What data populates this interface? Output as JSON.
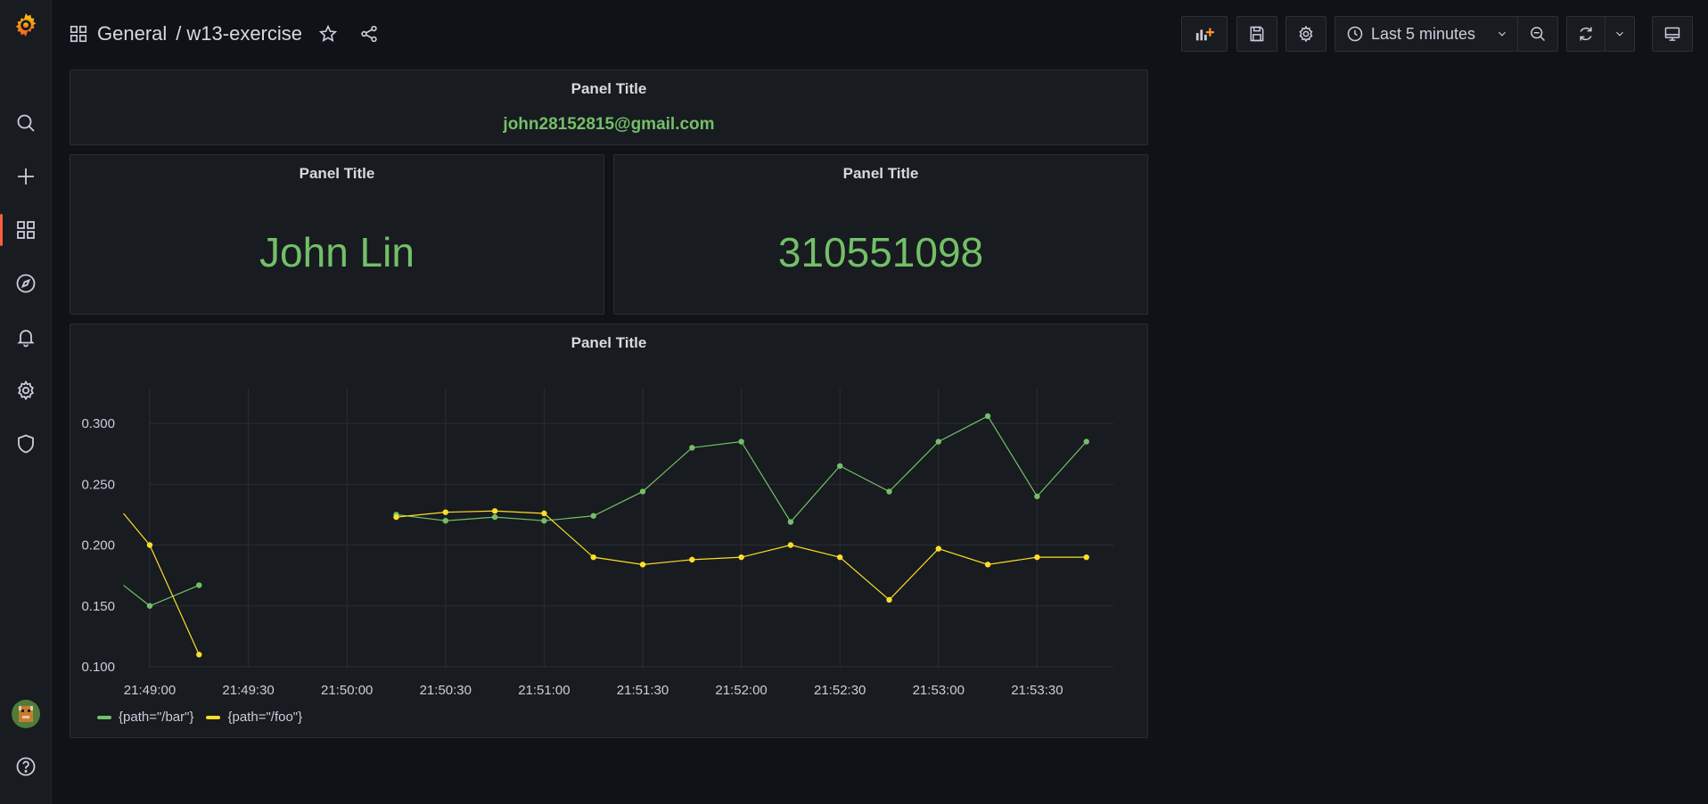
{
  "sidebar": {
    "items": [
      {
        "name": "grafana-logo"
      },
      {
        "name": "search"
      },
      {
        "name": "create"
      },
      {
        "name": "dashboards"
      },
      {
        "name": "explore"
      },
      {
        "name": "alerting"
      },
      {
        "name": "configuration"
      },
      {
        "name": "server-admin"
      },
      {
        "name": "user-avatar"
      },
      {
        "name": "help"
      }
    ]
  },
  "header": {
    "folder": "General",
    "separator": "/",
    "dashboard": "w13-exercise"
  },
  "toolbar": {
    "time_range": "Last 5 minutes"
  },
  "panels": {
    "email": {
      "title": "Panel Title",
      "value": "john28152815@gmail.com"
    },
    "name": {
      "title": "Panel Title",
      "value": "John Lin"
    },
    "id": {
      "title": "Panel Title",
      "value": "310551098"
    },
    "graph": {
      "title": "Panel Title"
    }
  },
  "colors": {
    "accent": "#f55f3e",
    "green": "#73bf69",
    "yellow": "#fade2a",
    "background": "#111217",
    "panel": "#181b1f"
  },
  "chart_data": {
    "type": "line",
    "title": "Panel Title",
    "xlabel": "",
    "ylabel": "",
    "x_ticks": [
      "21:49:00",
      "21:49:30",
      "21:50:00",
      "21:50:30",
      "21:51:00",
      "21:51:30",
      "21:52:00",
      "21:52:30",
      "21:53:00",
      "21:53:30"
    ],
    "y_ticks": [
      "0.100",
      "0.150",
      "0.200",
      "0.250",
      "0.300"
    ],
    "ylim": [
      0.1,
      0.3
    ],
    "grid": true,
    "legend_position": "bottom-left",
    "series": [
      {
        "name": "{path=\"/bar\"}",
        "color": "#73bf69",
        "segments": [
          [
            [
              "21:48:52",
              0.167
            ],
            [
              "21:49:00",
              0.15
            ],
            [
              "21:49:15",
              0.167
            ]
          ],
          [
            [
              "21:50:15",
              0.225
            ],
            [
              "21:50:30",
              0.22
            ],
            [
              "21:50:45",
              0.223
            ],
            [
              "21:51:00",
              0.22
            ],
            [
              "21:51:15",
              0.224
            ],
            [
              "21:51:30",
              0.244
            ],
            [
              "21:51:45",
              0.28
            ],
            [
              "21:52:00",
              0.285
            ],
            [
              "21:52:15",
              0.219
            ],
            [
              "21:52:30",
              0.265
            ],
            [
              "21:52:45",
              0.244
            ],
            [
              "21:53:00",
              0.285
            ],
            [
              "21:53:15",
              0.306
            ],
            [
              "21:53:30",
              0.24
            ],
            [
              "21:53:45",
              0.285
            ]
          ]
        ]
      },
      {
        "name": "{path=\"/foo\"}",
        "color": "#fade2a",
        "segments": [
          [
            [
              "21:48:52",
              0.226
            ],
            [
              "21:49:00",
              0.2
            ],
            [
              "21:49:15",
              0.11
            ]
          ],
          [
            [
              "21:50:15",
              0.223
            ],
            [
              "21:50:30",
              0.227
            ],
            [
              "21:50:45",
              0.228
            ],
            [
              "21:51:00",
              0.226
            ],
            [
              "21:51:15",
              0.19
            ],
            [
              "21:51:30",
              0.184
            ],
            [
              "21:51:45",
              0.188
            ],
            [
              "21:52:00",
              0.19
            ],
            [
              "21:52:15",
              0.2
            ],
            [
              "21:52:30",
              0.19
            ],
            [
              "21:52:45",
              0.155
            ],
            [
              "21:53:00",
              0.197
            ],
            [
              "21:53:15",
              0.184
            ],
            [
              "21:53:30",
              0.19
            ],
            [
              "21:53:45",
              0.19
            ]
          ]
        ]
      }
    ]
  }
}
